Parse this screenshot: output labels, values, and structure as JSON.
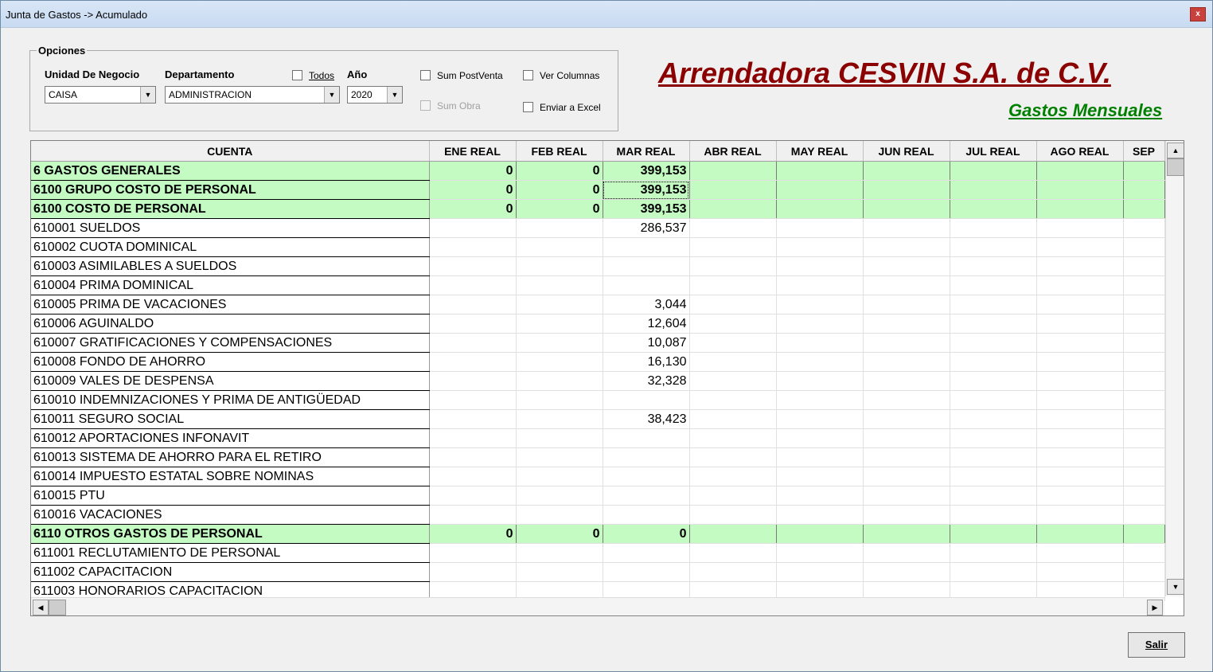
{
  "window": {
    "title": "Junta de Gastos -> Acumulado",
    "close_glyph": "x"
  },
  "options": {
    "legend": "Opciones",
    "unidad_label": "Unidad De Negocio",
    "unidad_value": "CAISA",
    "depto_label": "Departamento",
    "depto_value": "ADMINISTRACION",
    "todos_label": "Todos",
    "anio_label": "Año",
    "anio_value": "2020",
    "sum_postventa": "Sum PostVenta",
    "ver_columnas": "Ver Columnas",
    "sum_obra": "Sum Obra",
    "enviar_excel": "Enviar a Excel"
  },
  "header": {
    "company": "Arrendadora CESVIN S.A. de C.V.",
    "subtitle": "Gastos Mensuales"
  },
  "grid": {
    "columns": [
      "CUENTA",
      "ENE REAL",
      "FEB REAL",
      "MAR REAL",
      "ABR REAL",
      "MAY REAL",
      "JUN REAL",
      "JUL REAL",
      "AGO REAL",
      "SEP"
    ],
    "rows": [
      {
        "cells": [
          "6 GASTOS GENERALES",
          "0",
          "0",
          "399,153",
          "",
          "",
          "",
          "",
          "",
          ""
        ],
        "group": true
      },
      {
        "cells": [
          "6100 GRUPO COSTO DE PERSONAL",
          "0",
          "0",
          "399,153",
          "",
          "",
          "",
          "",
          "",
          ""
        ],
        "group": true,
        "focus": 3
      },
      {
        "cells": [
          "6100 COSTO DE PERSONAL",
          "0",
          "0",
          "399,153",
          "",
          "",
          "",
          "",
          "",
          ""
        ],
        "group": true
      },
      {
        "cells": [
          "610001 SUELDOS",
          "",
          "",
          "286,537",
          "",
          "",
          "",
          "",
          "",
          ""
        ]
      },
      {
        "cells": [
          "610002 CUOTA DOMINICAL",
          "",
          "",
          "",
          "",
          "",
          "",
          "",
          "",
          ""
        ]
      },
      {
        "cells": [
          "610003 ASIMILABLES A SUELDOS",
          "",
          "",
          "",
          "",
          "",
          "",
          "",
          "",
          ""
        ]
      },
      {
        "cells": [
          "610004 PRIMA DOMINICAL",
          "",
          "",
          "",
          "",
          "",
          "",
          "",
          "",
          ""
        ]
      },
      {
        "cells": [
          "610005 PRIMA DE VACACIONES",
          "",
          "",
          "3,044",
          "",
          "",
          "",
          "",
          "",
          ""
        ]
      },
      {
        "cells": [
          "610006 AGUINALDO",
          "",
          "",
          "12,604",
          "",
          "",
          "",
          "",
          "",
          ""
        ]
      },
      {
        "cells": [
          "610007 GRATIFICACIONES Y COMPENSACIONES",
          "",
          "",
          "10,087",
          "",
          "",
          "",
          "",
          "",
          ""
        ]
      },
      {
        "cells": [
          "610008 FONDO DE AHORRO",
          "",
          "",
          "16,130",
          "",
          "",
          "",
          "",
          "",
          ""
        ]
      },
      {
        "cells": [
          "610009 VALES DE DESPENSA",
          "",
          "",
          "32,328",
          "",
          "",
          "",
          "",
          "",
          ""
        ]
      },
      {
        "cells": [
          "610010 INDEMNIZACIONES Y PRIMA DE ANTIGÜEDAD",
          "",
          "",
          "",
          "",
          "",
          "",
          "",
          "",
          ""
        ]
      },
      {
        "cells": [
          "610011 SEGURO SOCIAL",
          "",
          "",
          "38,423",
          "",
          "",
          "",
          "",
          "",
          ""
        ]
      },
      {
        "cells": [
          "610012 APORTACIONES INFONAVIT",
          "",
          "",
          "",
          "",
          "",
          "",
          "",
          "",
          ""
        ]
      },
      {
        "cells": [
          "610013 SISTEMA DE AHORRO PARA EL RETIRO",
          "",
          "",
          "",
          "",
          "",
          "",
          "",
          "",
          ""
        ]
      },
      {
        "cells": [
          "610014 IMPUESTO ESTATAL SOBRE NOMINAS",
          "",
          "",
          "",
          "",
          "",
          "",
          "",
          "",
          ""
        ]
      },
      {
        "cells": [
          "610015 PTU",
          "",
          "",
          "",
          "",
          "",
          "",
          "",
          "",
          ""
        ]
      },
      {
        "cells": [
          "610016 VACACIONES",
          "",
          "",
          "",
          "",
          "",
          "",
          "",
          "",
          ""
        ]
      },
      {
        "cells": [
          "6110 OTROS GASTOS DE PERSONAL",
          "0",
          "0",
          "0",
          "",
          "",
          "",
          "",
          "",
          ""
        ],
        "group": true
      },
      {
        "cells": [
          "611001 RECLUTAMIENTO DE PERSONAL",
          "",
          "",
          "",
          "",
          "",
          "",
          "",
          "",
          ""
        ]
      },
      {
        "cells": [
          "611002 CAPACITACION",
          "",
          "",
          "",
          "",
          "",
          "",
          "",
          "",
          ""
        ]
      },
      {
        "cells": [
          "611003 HONORARIOS CAPACITACION",
          "",
          "",
          "",
          "",
          "",
          "",
          "",
          "",
          ""
        ]
      }
    ]
  },
  "footer": {
    "salir_label": "Salir"
  },
  "colors": {
    "company": "#8b0000",
    "subtitle": "#008000",
    "group_row": "#c3fbc3"
  }
}
